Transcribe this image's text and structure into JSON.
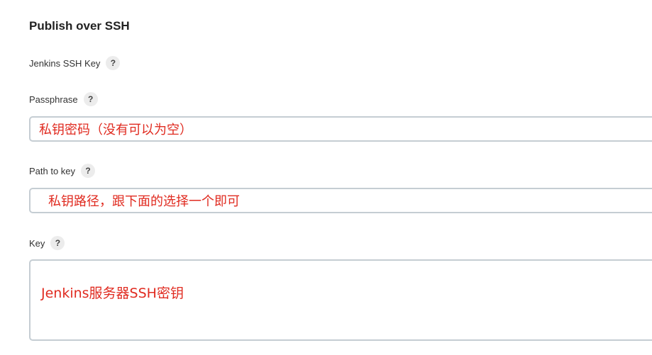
{
  "section": {
    "title": "Publish over SSH"
  },
  "fields": {
    "jenkins_ssh_key": {
      "label": "Jenkins SSH Key",
      "help": "?"
    },
    "passphrase": {
      "label": "Passphrase",
      "help": "?",
      "value": "私钥密码（没有可以为空）"
    },
    "path_to_key": {
      "label": "Path to key",
      "help": "?",
      "value": "私钥路径，跟下面的选择一个即可"
    },
    "key": {
      "label": "Key",
      "help": "?",
      "value": "Jenkins服务器SSH密钥"
    }
  },
  "colors": {
    "annotation_text": "#e02b20",
    "input_border": "#c5cdd3",
    "help_bg": "#ececec"
  },
  "icons": {
    "help": "question-mark-icon"
  }
}
